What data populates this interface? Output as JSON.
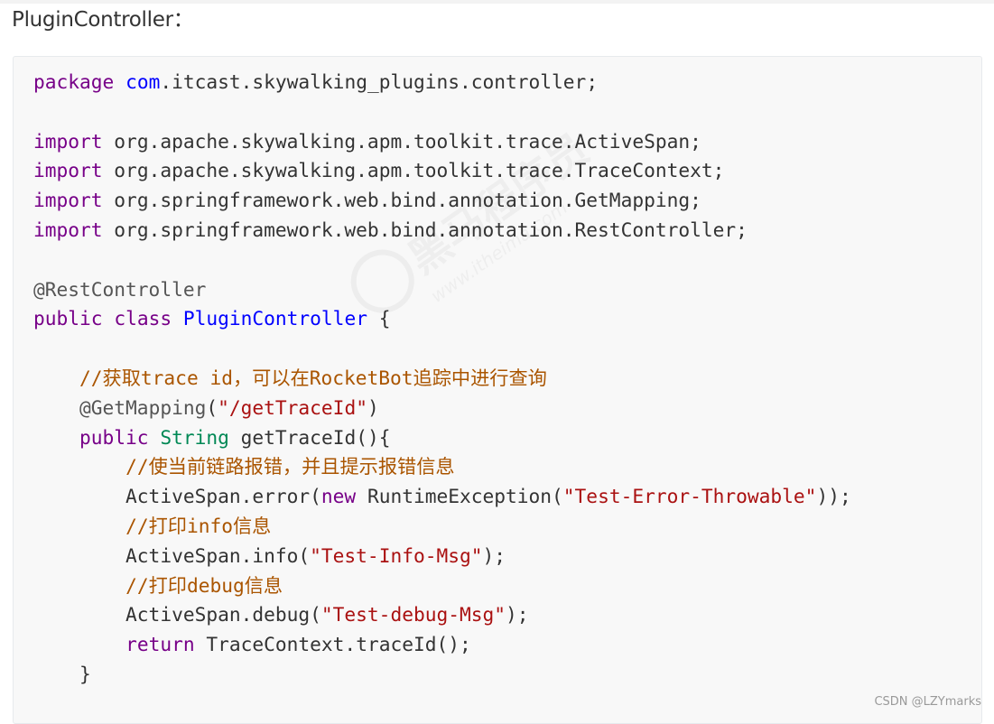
{
  "heading": "PluginController：",
  "watermark": {
    "brand": "黑马程序员",
    "url": "www.itheima.com"
  },
  "credit": "CSDN @LZYmarks",
  "code": {
    "language": "java",
    "lines": [
      [
        {
          "t": "package",
          "c": "kw"
        },
        {
          "t": " ",
          "c": ""
        },
        {
          "t": "com",
          "c": "pkg"
        },
        {
          "t": ".itcast.skywalking_plugins.controller;",
          "c": ""
        }
      ],
      [],
      [
        {
          "t": "import",
          "c": "kw"
        },
        {
          "t": " org.apache.skywalking.apm.toolkit.trace.ActiveSpan;",
          "c": ""
        }
      ],
      [
        {
          "t": "import",
          "c": "kw"
        },
        {
          "t": " org.apache.skywalking.apm.toolkit.trace.TraceContext;",
          "c": ""
        }
      ],
      [
        {
          "t": "import",
          "c": "kw"
        },
        {
          "t": " org.springframework.web.bind.annotation.GetMapping;",
          "c": ""
        }
      ],
      [
        {
          "t": "import",
          "c": "kw"
        },
        {
          "t": " org.springframework.web.bind.annotation.RestController;",
          "c": ""
        }
      ],
      [],
      [
        {
          "t": "@RestController",
          "c": "ann"
        }
      ],
      [
        {
          "t": "public",
          "c": "kw"
        },
        {
          "t": " ",
          "c": ""
        },
        {
          "t": "class",
          "c": "kw"
        },
        {
          "t": " ",
          "c": ""
        },
        {
          "t": "PluginController",
          "c": "def"
        },
        {
          "t": " {",
          "c": ""
        }
      ],
      [],
      [
        {
          "t": "    ",
          "c": ""
        },
        {
          "t": "//获取trace id，可以在RocketBot追踪中进行查询",
          "c": "cmt"
        }
      ],
      [
        {
          "t": "    ",
          "c": ""
        },
        {
          "t": "@GetMapping",
          "c": "ann"
        },
        {
          "t": "(",
          "c": ""
        },
        {
          "t": "\"/getTraceId\"",
          "c": "str"
        },
        {
          "t": ")",
          "c": ""
        }
      ],
      [
        {
          "t": "    ",
          "c": ""
        },
        {
          "t": "public",
          "c": "kw"
        },
        {
          "t": " ",
          "c": ""
        },
        {
          "t": "String",
          "c": "type"
        },
        {
          "t": " getTraceId(){",
          "c": ""
        }
      ],
      [
        {
          "t": "        ",
          "c": ""
        },
        {
          "t": "//使当前链路报错，并且提示报错信息",
          "c": "cmt"
        }
      ],
      [
        {
          "t": "        ActiveSpan.error(",
          "c": ""
        },
        {
          "t": "new",
          "c": "kw"
        },
        {
          "t": " RuntimeException(",
          "c": ""
        },
        {
          "t": "\"Test-Error-Throwable\"",
          "c": "str"
        },
        {
          "t": "));",
          "c": ""
        }
      ],
      [
        {
          "t": "        ",
          "c": ""
        },
        {
          "t": "//打印info信息",
          "c": "cmt"
        }
      ],
      [
        {
          "t": "        ActiveSpan.info(",
          "c": ""
        },
        {
          "t": "\"Test-Info-Msg\"",
          "c": "str"
        },
        {
          "t": ");",
          "c": ""
        }
      ],
      [
        {
          "t": "        ",
          "c": ""
        },
        {
          "t": "//打印debug信息",
          "c": "cmt"
        }
      ],
      [
        {
          "t": "        ActiveSpan.debug(",
          "c": ""
        },
        {
          "t": "\"Test-debug-Msg\"",
          "c": "str"
        },
        {
          "t": ");",
          "c": ""
        }
      ],
      [
        {
          "t": "        ",
          "c": ""
        },
        {
          "t": "return",
          "c": "kw"
        },
        {
          "t": " TraceContext.traceId();",
          "c": ""
        }
      ],
      [
        {
          "t": "    }",
          "c": ""
        }
      ]
    ]
  }
}
